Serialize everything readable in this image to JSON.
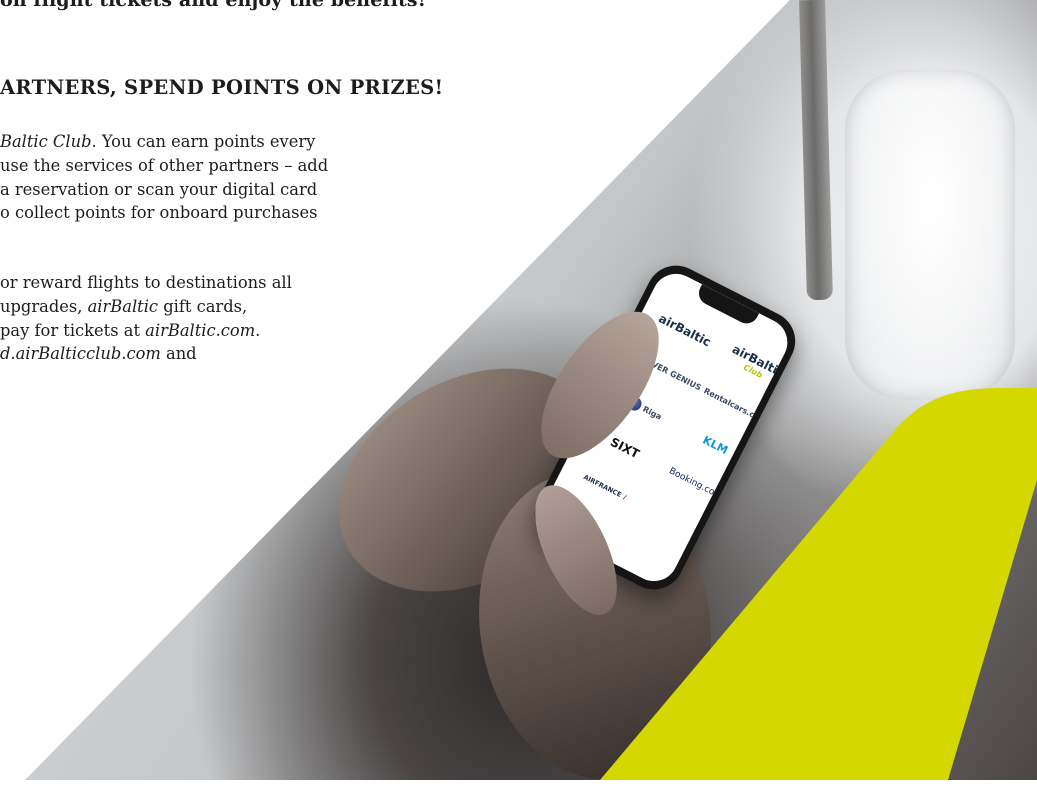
{
  "intro": {
    "line": "on flight tickets and enjoy the benefits!"
  },
  "section": {
    "heading": "ARTNERS, SPEND POINTS ON PRIZES!",
    "paragraph1": {
      "l1_italic": "Baltic Club",
      "l1_rest": ". You can earn points every",
      "l2": "use the services of other partners – add",
      "l3": "a reservation or scan your digital card",
      "l4": "o collect points for onboard purchases"
    },
    "paragraph2": {
      "l1": "or reward flights to destinations all",
      "l2_a": " upgrades, ",
      "l2_italic": "airBaltic",
      "l2_b": " gift cards,",
      "l3_a": "pay for tickets at ",
      "l3_italic": "airBaltic.com",
      "l3_b": ".",
      "l4_italic": "d.airBalticclub.com",
      "l4_b": " and"
    }
  },
  "phone_screen": {
    "logos": [
      {
        "id": "airbaltic",
        "text": "airBaltic"
      },
      {
        "id": "airbaltic-club",
        "text": "airBaltic",
        "sub": "Club"
      },
      {
        "id": "cover-genius",
        "text": "COVER GENIUS"
      },
      {
        "id": "rentalcars",
        "text": "Rentalcars.com"
      },
      {
        "id": "partner-round",
        "text": "Riga"
      },
      {
        "id": "klm",
        "text": "KLM"
      },
      {
        "id": "sixt",
        "text": "SIXT"
      },
      {
        "id": "booking",
        "text": "Booking.com"
      },
      {
        "id": "airfrance",
        "text": "AIRFRANCE",
        "mark": "/"
      }
    ]
  },
  "colors": {
    "lime": "#d4d800",
    "text": "#1c1c1c"
  }
}
